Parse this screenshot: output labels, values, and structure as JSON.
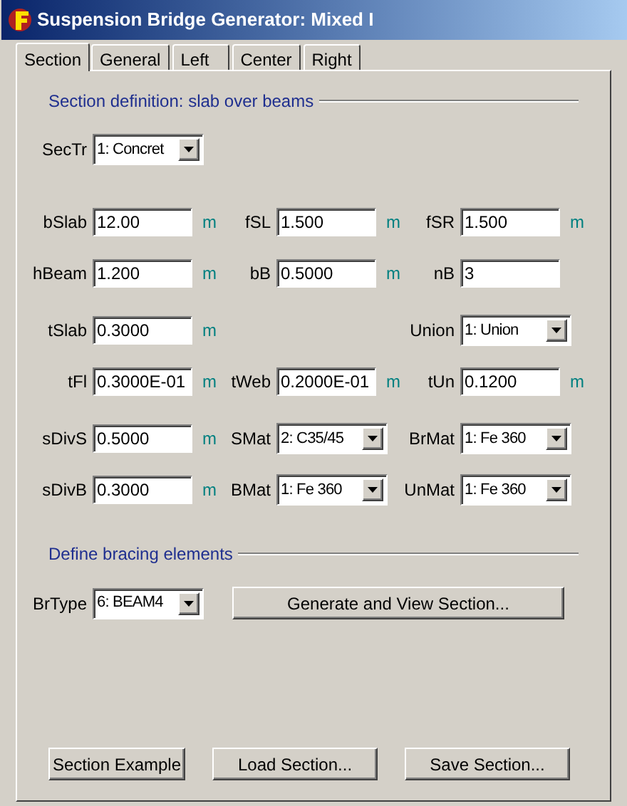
{
  "window": {
    "title": "Suspension Bridge Generator: Mixed I"
  },
  "tabs": [
    {
      "label": "Section",
      "selected": true
    },
    {
      "label": "General",
      "selected": false
    },
    {
      "label": "Left",
      "selected": false
    },
    {
      "label": "Center",
      "selected": false
    },
    {
      "label": "Right",
      "selected": false
    }
  ],
  "section_header": "Section definition: slab over beams",
  "section_type": {
    "label": "SecTr",
    "kind": "select",
    "value": "1: Concret"
  },
  "rows": [
    [
      {
        "label": "bSlab",
        "kind": "text",
        "value": "12.00",
        "unit": "m"
      },
      {
        "label": "fSL",
        "kind": "text",
        "value": "1.500",
        "unit": "m"
      },
      {
        "label": "fSR",
        "kind": "text",
        "value": "1.500",
        "unit": "m"
      }
    ],
    [
      {
        "label": "hBeam",
        "kind": "text",
        "value": "1.200",
        "unit": "m"
      },
      {
        "label": "bB",
        "kind": "text",
        "value": "0.5000",
        "unit": "m"
      },
      {
        "label": "nB",
        "kind": "text",
        "value": "3"
      }
    ],
    [
      {
        "label": "tSlab",
        "kind": "text",
        "value": "0.3000",
        "unit": "m"
      },
      null,
      {
        "label": "Union",
        "kind": "select",
        "value": "1: Union"
      }
    ],
    [
      {
        "label": "tFl",
        "kind": "text",
        "value": "0.3000E-01",
        "unit": "m"
      },
      {
        "label": "tWeb",
        "kind": "text",
        "value": "0.2000E-01",
        "unit": "m"
      },
      {
        "label": "tUn",
        "kind": "text",
        "value": "0.1200",
        "unit": "m"
      }
    ],
    [
      {
        "label": "sDivS",
        "kind": "text",
        "value": "0.5000",
        "unit": "m"
      },
      {
        "label": "SMat",
        "kind": "select",
        "value": "2: C35/45"
      },
      {
        "label": "BrMat",
        "kind": "select",
        "value": "1: Fe 360"
      }
    ],
    [
      {
        "label": "sDivB",
        "kind": "text",
        "value": "0.3000",
        "unit": "m"
      },
      {
        "label": "BMat",
        "kind": "select",
        "value": "1: Fe 360"
      },
      {
        "label": "UnMat",
        "kind": "select",
        "value": "1: Fe 360"
      }
    ]
  ],
  "bracing_header": "Define bracing elements",
  "bracing_type": {
    "label": "BrType",
    "kind": "select",
    "value": "6: BEAM4"
  },
  "generate_button": "Generate and View Section...",
  "buttons": [
    "Section Example",
    "Load Section...",
    "Save Section..."
  ]
}
